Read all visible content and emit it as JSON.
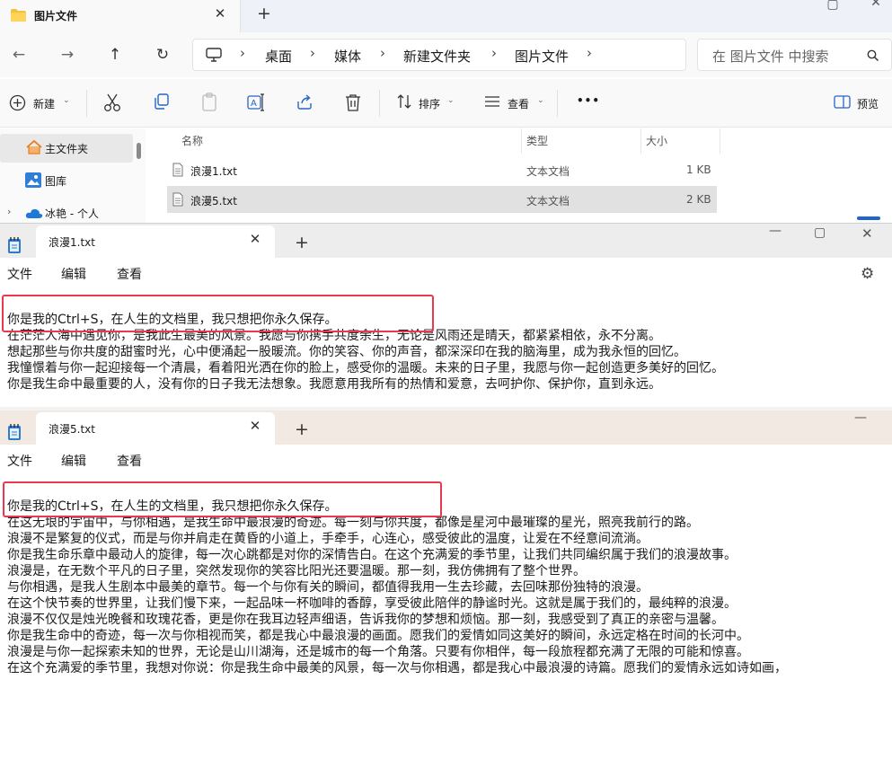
{
  "explorer": {
    "tab_title": "图片文件",
    "breadcrumb": [
      "桌面",
      "媒体",
      "新建文件夹",
      "图片文件"
    ],
    "search_placeholder": "在 图片文件 中搜索",
    "toolbar": {
      "new_label": "新建",
      "sort_label": "排序",
      "view_label": "查看",
      "more_label": "•••",
      "preview_label": "预览"
    },
    "sidebar": [
      {
        "label": "主文件夹"
      },
      {
        "label": "图库"
      },
      {
        "label": "冰艳 - 个人"
      }
    ],
    "columns": {
      "name": "名称",
      "type": "类型",
      "size": "大小"
    },
    "files": [
      {
        "name": "浪漫1.txt",
        "type": "文本文档",
        "size": "1 KB"
      },
      {
        "name": "浪漫5.txt",
        "type": "文本文档",
        "size": "2 KB"
      }
    ]
  },
  "notepad1": {
    "tab_title": "浪漫1.txt",
    "menu": [
      "文件",
      "编辑",
      "查看"
    ],
    "lines": [
      "你是我的Ctrl+S，在人生的文档里，我只想把你永久保存。",
      "在茫茫人海中遇见你，是我此生最美的风景。我愿与你携手共度余生，无论是风雨还是晴天，都紧紧相依，永不分离。",
      "想起那些与你共度的甜蜜时光，心中便涌起一股暖流。你的笑容、你的声音，都深深印在我的脑海里，成为我永恒的回忆。",
      "我憧憬着与你一起迎接每一个清晨，看着阳光洒在你的脸上，感受你的温暖。未来的日子里，我愿与你一起创造更多美好的回忆。",
      "你是我生命中最重要的人，没有你的日子我无法想象。我愿意用我所有的热情和爱意，去呵护你、保护你，直到永远。"
    ]
  },
  "notepad2": {
    "tab_title": "浪漫5.txt",
    "menu": [
      "文件",
      "编辑",
      "查看"
    ],
    "lines": [
      "你是我的Ctrl+S，在人生的文档里，我只想把你永久保存。",
      "在这无垠的宇宙中，与你相遇，是我生命中最浪漫的奇迹。每一刻与你共度，都像是星河中最璀璨的星光，照亮我前行的路。",
      "浪漫不是繁复的仪式，而是与你并肩走在黄昏的小道上，手牵手，心连心，感受彼此的温度，让爱在不经意间流淌。",
      "你是我生命乐章中最动人的旋律，每一次心跳都是对你的深情告白。在这个充满爱的季节里，让我们共同编织属于我们的浪漫故事。",
      "浪漫是，在无数个平凡的日子里，突然发现你的笑容比阳光还要温暖。那一刻，我仿佛拥有了整个世界。",
      "与你相遇，是我人生剧本中最美的章节。每一个与你有关的瞬间，都值得我用一生去珍藏，去回味那份独特的浪漫。",
      "在这个快节奏的世界里，让我们慢下来，一起品味一杯咖啡的香醇，享受彼此陪伴的静谧时光。这就是属于我们的，最纯粹的浪漫。",
      "浪漫不仅仅是烛光晚餐和玫瑰花香，更是你在我耳边轻声细语，告诉我你的梦想和烦恼。那一刻，我感受到了真正的亲密与温馨。",
      "你是我生命中的奇迹，每一次与你相视而笑，都是我心中最浪漫的画面。愿我们的爱情如同这美好的瞬间，永远定格在时间的长河中。",
      "浪漫是与你一起探索未知的世界，无论是山川湖海，还是城市的每一个角落。只要有你相伴，每一段旅程都充满了无限的可能和惊喜。",
      "在这个充满爱的季节里，我想对你说：你是我生命中最美的风景，每一次与你相遇，都是我心中最浪漫的诗篇。愿我们的爱情永远如诗如画，"
    ]
  }
}
